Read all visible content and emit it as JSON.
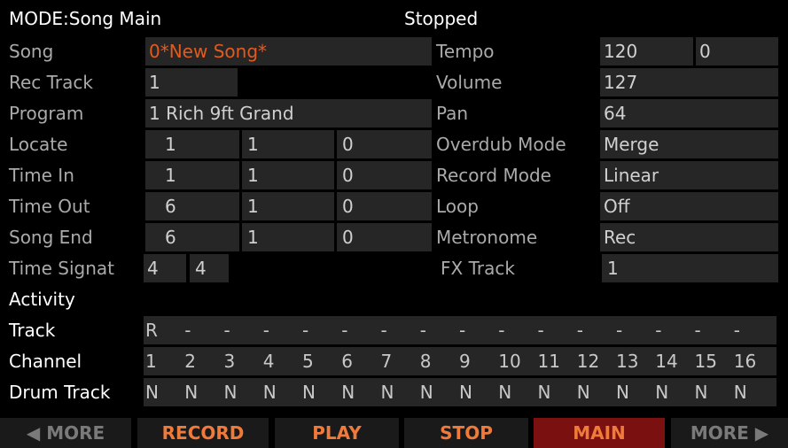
{
  "header": {
    "mode": "MODE:Song Main",
    "status": "Stopped"
  },
  "left": {
    "song_label": "Song",
    "song_value": "0*New Song*",
    "rectrack_label": "Rec Track",
    "rectrack_value": "1",
    "program_label": "Program",
    "program_value": "1 Rich 9ft Grand",
    "locate_label": "Locate",
    "locate": [
      "1",
      "1",
      "0"
    ],
    "timein_label": "Time In",
    "timein": [
      "1",
      "1",
      "0"
    ],
    "timeout_label": "Time Out",
    "timeout": [
      "6",
      "1",
      "0"
    ],
    "songend_label": "Song End",
    "songend": [
      "6",
      "1",
      "0"
    ],
    "timesig_label": "Time Signat",
    "timesig": [
      "4",
      "4"
    ]
  },
  "right": {
    "tempo_label": "Tempo",
    "tempo": [
      "120",
      "0"
    ],
    "volume_label": "Volume",
    "volume_value": "127",
    "pan_label": "Pan",
    "pan_value": "64",
    "overdub_label": "Overdub Mode",
    "overdub_value": "Merge",
    "recmode_label": "Record Mode",
    "recmode_value": "Linear",
    "loop_label": "Loop",
    "loop_value": "Off",
    "metronome_label": "Metronome",
    "metronome_value": "Rec",
    "fxtrack_label": "FX Track",
    "fxtrack_value": "1"
  },
  "activity": {
    "title": "Activity",
    "track_label": "Track",
    "track_cells": [
      "R",
      "-",
      "-",
      "-",
      "-",
      "-",
      "-",
      "-",
      "-",
      "-",
      "-",
      "-",
      "-",
      "-",
      "-",
      "-"
    ],
    "channel_label": "Channel",
    "channel_cells": [
      "1",
      "2",
      "3",
      "4",
      "5",
      "6",
      "7",
      "8",
      "9",
      "10",
      "11",
      "12",
      "13",
      "14",
      "15",
      "16"
    ],
    "drum_label": "Drum Track",
    "drum_cells": [
      "N",
      "N",
      "N",
      "N",
      "N",
      "N",
      "N",
      "N",
      "N",
      "N",
      "N",
      "N",
      "N",
      "N",
      "N",
      "N"
    ]
  },
  "softbuttons": {
    "more_left": "◀ MORE",
    "record": "RECORD",
    "play": "PLAY",
    "stop": "STOP",
    "main": "MAIN",
    "more_right": "MORE ▶"
  }
}
